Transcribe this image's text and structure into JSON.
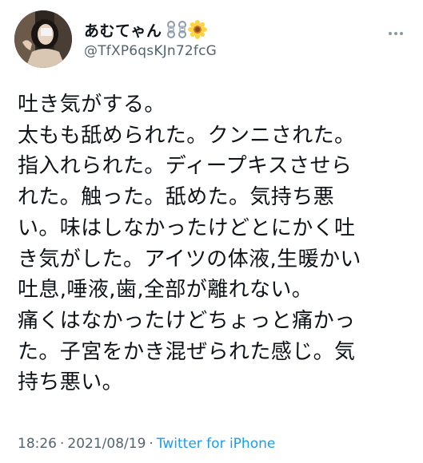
{
  "author": {
    "display_name": "あむてゃん",
    "handle": "@TfXP6qsKJn72fcG",
    "avatar_icon": "profile-photo-icon",
    "emoji_icons": [
      "chain-link-icon",
      "chain-link-icon",
      "sunflower-icon"
    ]
  },
  "tweet": {
    "lines": [
      "吐き気がする。",
      "太もも舐められた。クンニされた。",
      "指入れられた。ディープキスさせら",
      "れた。触った。舐めた。気持ち悪",
      "い。味はしなかったけどとにかく吐",
      "き気がした。アイツの体液,生暖かい",
      "吐息,唾液,歯,全部が離れない。",
      "痛くはなかったけどちょっと痛かっ",
      "た。子宮をかき混ぜられた感じ。気",
      "持ち悪い。"
    ]
  },
  "meta": {
    "time": "18:26",
    "date": "2021/08/19",
    "source": "Twitter for iPhone",
    "separator": "·"
  },
  "colors": {
    "text": "#0f1419",
    "secondary": "#536471",
    "link": "#1d9bf0"
  }
}
